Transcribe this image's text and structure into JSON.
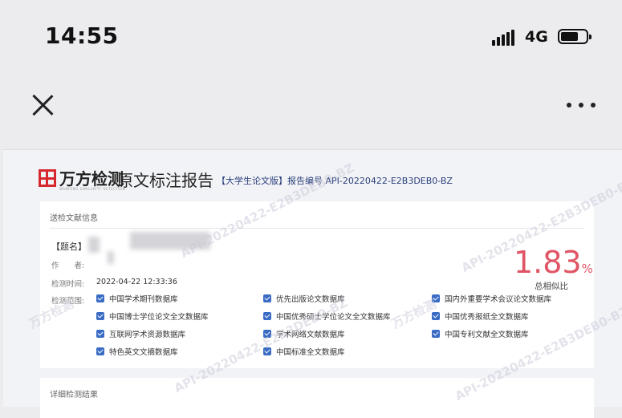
{
  "status_bar": {
    "time": "14:55",
    "network": "4G",
    "battery_level": 0.6
  },
  "nav": {
    "close_icon": "close-icon",
    "more_icon": "more-icon"
  },
  "report": {
    "logo_text": "万方检测",
    "logo_sub": "WANFANG SIMILARITY DETECTION",
    "title": "原文标注报告",
    "meta": "【大学生论文版】报告编号 API-20220422-E2B3DEB0-BZ",
    "section1_label": "送检文献信息",
    "title_field": "【题名】",
    "author_label": "作　　者:",
    "time_label": "检测时间:",
    "time_value": "2022-04-22 12:33:36",
    "scope_label": "检测范围:",
    "similarity": "1.83",
    "similarity_unit": "%",
    "similarity_label": "总相似比",
    "databases": [
      "中国学术期刊数据库",
      "优先出版论文数据库",
      "国内外重要学术会议论文数据库",
      "中国博士学位论文全文数据库",
      "中国优秀硕士学位论文全文数据库",
      "中国优秀报纸全文数据库",
      "互联网学术资源数据库",
      "学术网络文献数据库",
      "中国专利文献全文数据库",
      "特色英文文摘数据库",
      "中国标准全文数据库"
    ],
    "section2_label": "详细检测结果",
    "watermark_a": "API-20220422-E2B3DEB0-BZ",
    "watermark_b": "万方检测"
  },
  "colors": {
    "accent": "#e05565",
    "brand": "#d7282f",
    "check": "#3a6cc5",
    "meta": "#2a3f7a"
  }
}
